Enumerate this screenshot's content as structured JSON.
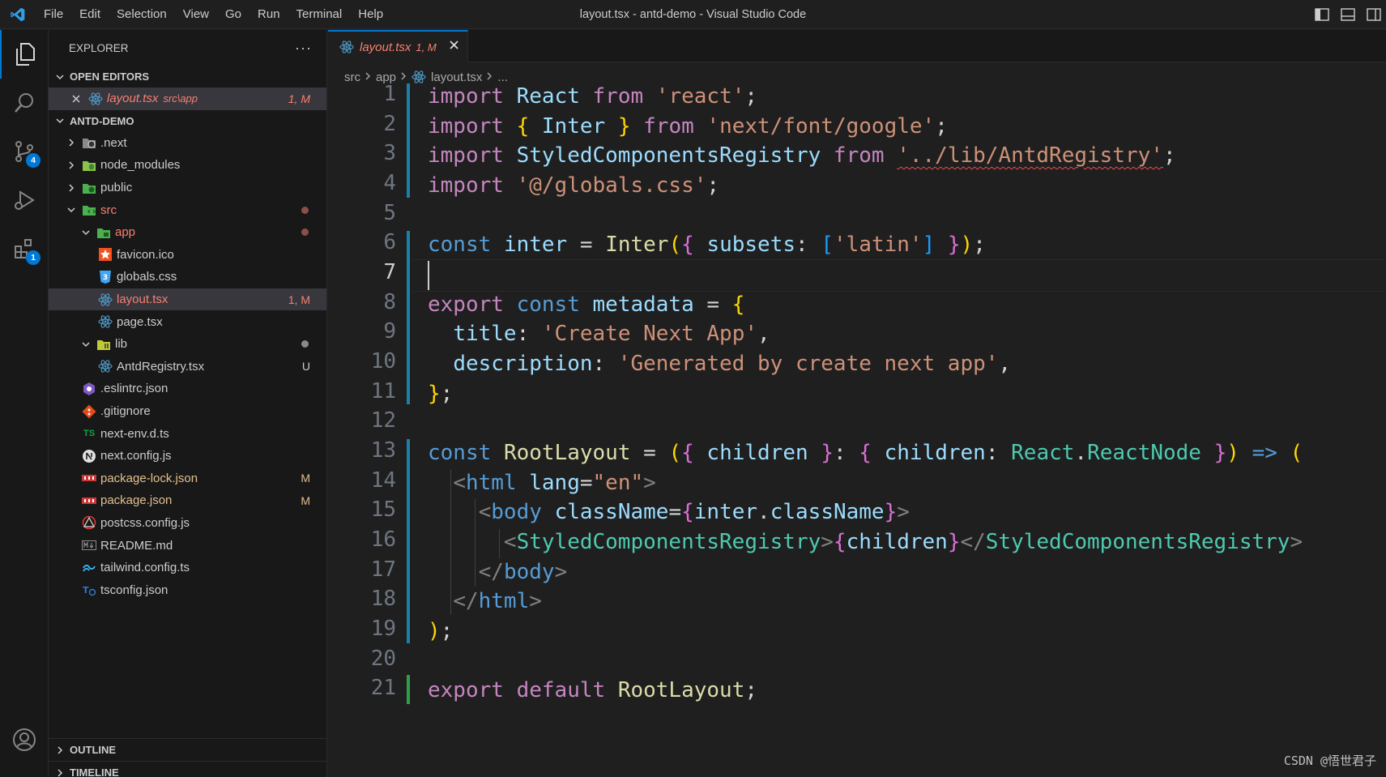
{
  "titlebar": {
    "menu": [
      "File",
      "Edit",
      "Selection",
      "View",
      "Go",
      "Run",
      "Terminal",
      "Help"
    ],
    "window_title": "layout.tsx - antd-demo - Visual Studio Code"
  },
  "activitybar": {
    "scm_badge": "4",
    "extensions_badge": "1"
  },
  "sidebar": {
    "title": "EXPLORER",
    "more": "···",
    "open_editors": {
      "title": "OPEN EDITORS",
      "items": [
        {
          "name": "layout.tsx",
          "path": "src\\app",
          "status": "1, M"
        }
      ]
    },
    "project": {
      "title": "ANTD-DEMO",
      "items": [
        {
          "name": ".next",
          "status": ""
        },
        {
          "name": "node_modules",
          "status": ""
        },
        {
          "name": "public",
          "status": ""
        },
        {
          "name": "src",
          "status": ""
        },
        {
          "name": "app",
          "status": ""
        },
        {
          "name": "favicon.ico",
          "status": ""
        },
        {
          "name": "globals.css",
          "status": ""
        },
        {
          "name": "layout.tsx",
          "status": "1, M"
        },
        {
          "name": "page.tsx",
          "status": ""
        },
        {
          "name": "lib",
          "status": ""
        },
        {
          "name": "AntdRegistry.tsx",
          "status": "U"
        },
        {
          "name": ".eslintrc.json",
          "status": ""
        },
        {
          "name": ".gitignore",
          "status": ""
        },
        {
          "name": "next-env.d.ts",
          "status": ""
        },
        {
          "name": "next.config.js",
          "status": ""
        },
        {
          "name": "package-lock.json",
          "status": "M"
        },
        {
          "name": "package.json",
          "status": "M"
        },
        {
          "name": "postcss.config.js",
          "status": ""
        },
        {
          "name": "README.md",
          "status": ""
        },
        {
          "name": "tailwind.config.ts",
          "status": ""
        },
        {
          "name": "tsconfig.json",
          "status": ""
        }
      ]
    },
    "outline": "OUTLINE",
    "timeline": "TIMELINE",
    "ts_label": "TS"
  },
  "editor": {
    "tab": {
      "name": "layout.tsx",
      "status": "1, M"
    },
    "breadcrumb": [
      "src",
      "app",
      "layout.tsx",
      "..."
    ],
    "line_numbers": [
      "1",
      "2",
      "3",
      "4",
      "5",
      "6",
      "7",
      "8",
      "9",
      "10",
      "11",
      "12",
      "13",
      "14",
      "15",
      "16",
      "17",
      "18",
      "19",
      "20",
      "21"
    ],
    "code": {
      "l1": [
        "import",
        "React",
        "from",
        "'react'",
        ";"
      ],
      "l2": [
        "import",
        "{",
        "Inter",
        "}",
        "from",
        "'next/font/google'",
        ";"
      ],
      "l3": [
        "import",
        "StyledComponentsRegistry",
        "from",
        "'../lib/AntdRegistry'",
        ";"
      ],
      "l4": [
        "import",
        "'@/globals.css'",
        ";"
      ],
      "l6": [
        "const",
        "inter",
        "=",
        "Inter",
        "(",
        "{",
        "subsets",
        ":",
        "[",
        "'latin'",
        "]",
        "}",
        ")",
        ";"
      ],
      "l8": [
        "export",
        "const",
        "metadata",
        "=",
        "{"
      ],
      "l9": [
        "title",
        ":",
        "'Create Next App'",
        ","
      ],
      "l10": [
        "description",
        ":",
        "'Generated by create next app'",
        ","
      ],
      "l11": [
        "}",
        ";"
      ],
      "l13": [
        "const",
        "RootLayout",
        "=",
        "(",
        "{",
        "children",
        "}",
        ":",
        "{",
        "children",
        ":",
        "React",
        ".",
        "ReactNode",
        "}",
        ")",
        "=>",
        "("
      ],
      "l14": [
        "<",
        "html",
        "lang",
        "=",
        "\"en\"",
        ">"
      ],
      "l15": [
        "<",
        "body",
        "className",
        "=",
        "{",
        "inter",
        ".",
        "className",
        "}",
        ">"
      ],
      "l16": [
        "<",
        "StyledComponentsRegistry",
        ">",
        "{",
        "children",
        "}",
        "</",
        "StyledComponentsRegistry",
        ">"
      ],
      "l17": [
        "</",
        "body",
        ">"
      ],
      "l18": [
        "</",
        "html",
        ">"
      ],
      "l19": [
        ")",
        ";"
      ],
      "l21": [
        "export",
        "default",
        "RootLayout",
        ";"
      ]
    }
  },
  "watermark": "CSDN @悟世君子",
  "colors": {
    "accent": "#0078d4",
    "error": "#f88070",
    "modified": "#e2c08d"
  }
}
